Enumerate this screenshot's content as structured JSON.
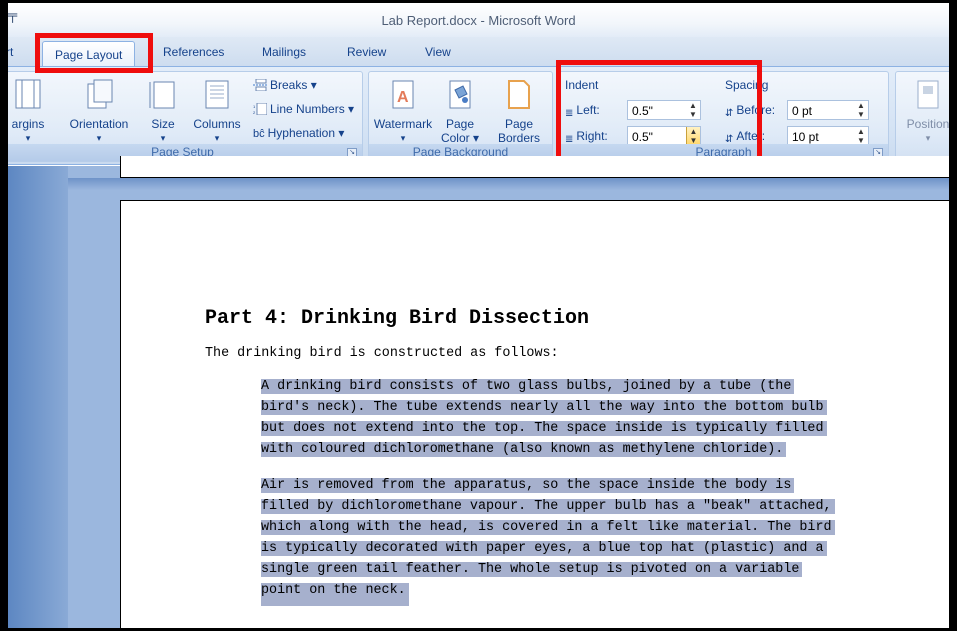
{
  "window": {
    "title": "Lab Report.docx - Microsoft Word",
    "qat_glyph": "╤"
  },
  "tabs": [
    {
      "label": "rt"
    },
    {
      "label": "Page Layout",
      "active": true
    },
    {
      "label": "References"
    },
    {
      "label": "Mailings"
    },
    {
      "label": "Review"
    },
    {
      "label": "View"
    }
  ],
  "ribbon": {
    "page_setup": {
      "label": "Page Setup",
      "margins": "argins",
      "orientation": "Orientation",
      "size": "Size",
      "columns": "Columns",
      "breaks": "Breaks",
      "line_numbers": "Line Numbers",
      "hyphenation": "Hyphenation",
      "hyphen_glyph": "bĉ"
    },
    "page_background": {
      "label": "Page Background",
      "watermark": "Watermark",
      "page_color_1": "Page",
      "page_color_2": "Color",
      "page_borders_1": "Page",
      "page_borders_2": "Borders"
    },
    "paragraph": {
      "label": "Paragraph",
      "indent_title": "Indent",
      "left_label": "Left:",
      "left_value": "0.5\"",
      "right_label": "Right:",
      "right_value": "0.5\"",
      "spacing_title": "Spacing",
      "before_label": "Before:",
      "before_value": "0 pt",
      "after_label": "After:",
      "after_value": "10 pt"
    },
    "arrange": {
      "position": "Position"
    }
  },
  "document": {
    "heading": "Part 4: Drinking Bird Dissection",
    "intro": "The drinking bird is constructed as follows:",
    "para1": [
      "A drinking bird consists of two glass bulbs, joined by a tube (the",
      "bird's neck). The tube extends nearly all the way into the bottom bulb",
      "but does not extend into the top. The space inside is typically filled",
      "with coloured dichloromethane (also known as methylene chloride)."
    ],
    "para2": [
      "Air is removed from the apparatus, so the space inside the body is",
      "filled by dichloromethane vapour. The upper bulb has a \"beak\" attached,",
      "which along with the head, is covered in a felt like material. The bird",
      "is typically decorated with paper eyes, a blue top hat (plastic) and a",
      "single green tail feather. The whole setup is pivoted on a variable",
      "point on the neck."
    ]
  },
  "colors": {
    "highlight": "#ef0d0d",
    "selection": "#a6b0cd",
    "ribbon": "#d3e2f4"
  }
}
